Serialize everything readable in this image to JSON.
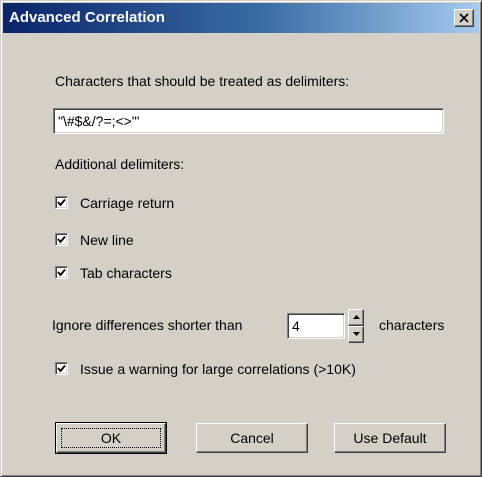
{
  "window": {
    "title": "Advanced Correlation",
    "close_glyph": "X"
  },
  "delimiters": {
    "label": "Characters that should be treated as delimiters:",
    "value": "\"\\#$&/?=;<>\"'"
  },
  "additional": {
    "label": "Additional delimiters:",
    "options": [
      {
        "label": "Carriage return",
        "checked": true
      },
      {
        "label": "New line",
        "checked": true
      },
      {
        "label": "Tab characters",
        "checked": true
      }
    ]
  },
  "ignore": {
    "prefix": "Ignore differences shorter than",
    "value": "4",
    "suffix": "characters"
  },
  "warning": {
    "label": "Issue a warning for large correlations (>10K)",
    "checked": true
  },
  "buttons": {
    "ok": "OK",
    "cancel": "Cancel",
    "use_default": "Use Default"
  },
  "colors": {
    "title_start": "#0a246a",
    "title_end": "#a6caf0",
    "face": "#d4d0c8"
  }
}
